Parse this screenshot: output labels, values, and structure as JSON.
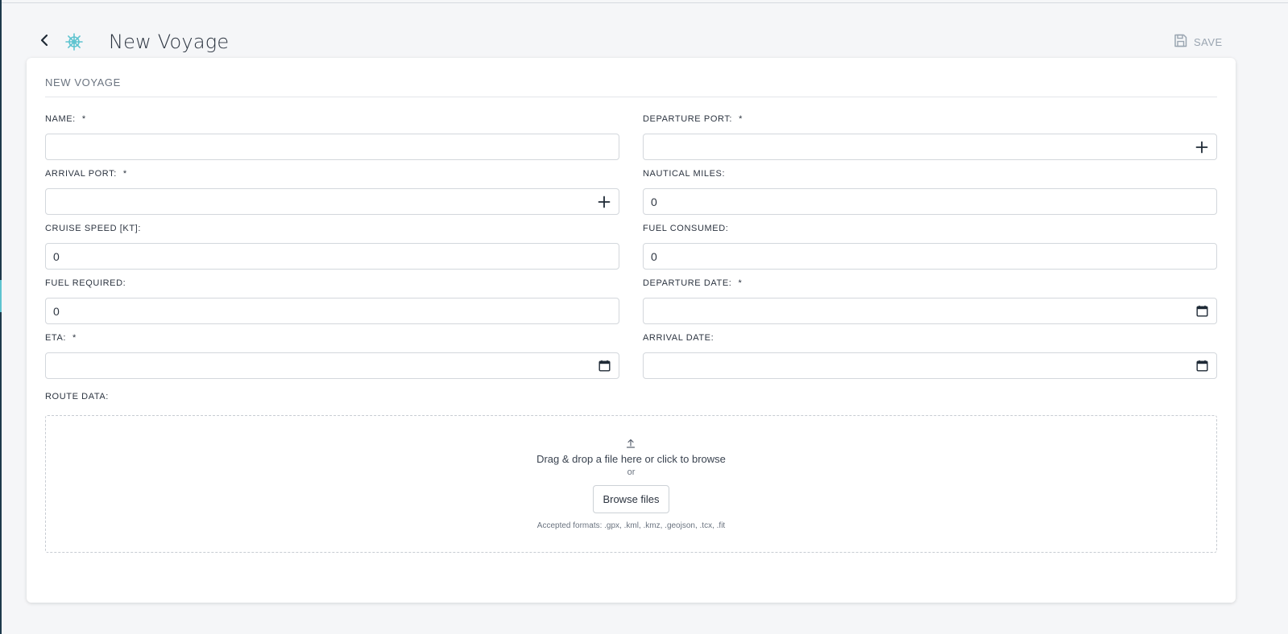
{
  "header": {
    "back_icon": "chevron-left-icon",
    "app_icon": "ship-wheel-icon",
    "title": "New Voyage",
    "save_label": "SAVE",
    "save_icon": "floppy-disk-icon"
  },
  "form": {
    "section_title": "NEW VOYAGE",
    "fields": [
      {
        "label": "NAME:",
        "required": "*",
        "value": ""
      },
      {
        "label": "DEPARTURE PORT:",
        "required": "*",
        "value": "",
        "icon": "plus-icon"
      },
      {
        "label": "ARRIVAL PORT:",
        "required": "*",
        "value": "",
        "icon": "plus-icon"
      },
      {
        "label": "NAUTICAL MILES:",
        "required": "",
        "value": "0"
      },
      {
        "label": "CRUISE SPEED [KT]:",
        "required": "",
        "value": "0"
      },
      {
        "label": "FUEL CONSUMED:",
        "required": "",
        "value": "0"
      },
      {
        "label": "FUEL REQUIRED:",
        "required": "",
        "value": "0"
      },
      {
        "label": "DEPARTURE DATE:",
        "required": "*",
        "value": "",
        "icon": "calendar-icon"
      },
      {
        "label": "ETA:",
        "required": "*",
        "value": "",
        "icon": "calendar-icon"
      },
      {
        "label": "ARRIVAL DATE:",
        "required": "",
        "value": "",
        "icon": "calendar-icon"
      }
    ],
    "route": {
      "label": "ROUTE DATA:",
      "upload_icon": "upload-icon",
      "drop_text": "Drag & drop a file here or click to browse",
      "or_text": "or",
      "browse_label": "Browse files",
      "accepted_text": "Accepted formats: .gpx, .kml, .kmz, .geojson, .tcx, .fit"
    }
  },
  "colors": {
    "accent": "#5ec4d0",
    "text": "#2c3440",
    "muted": "#9aa5b1",
    "border": "#d3d7dc"
  }
}
